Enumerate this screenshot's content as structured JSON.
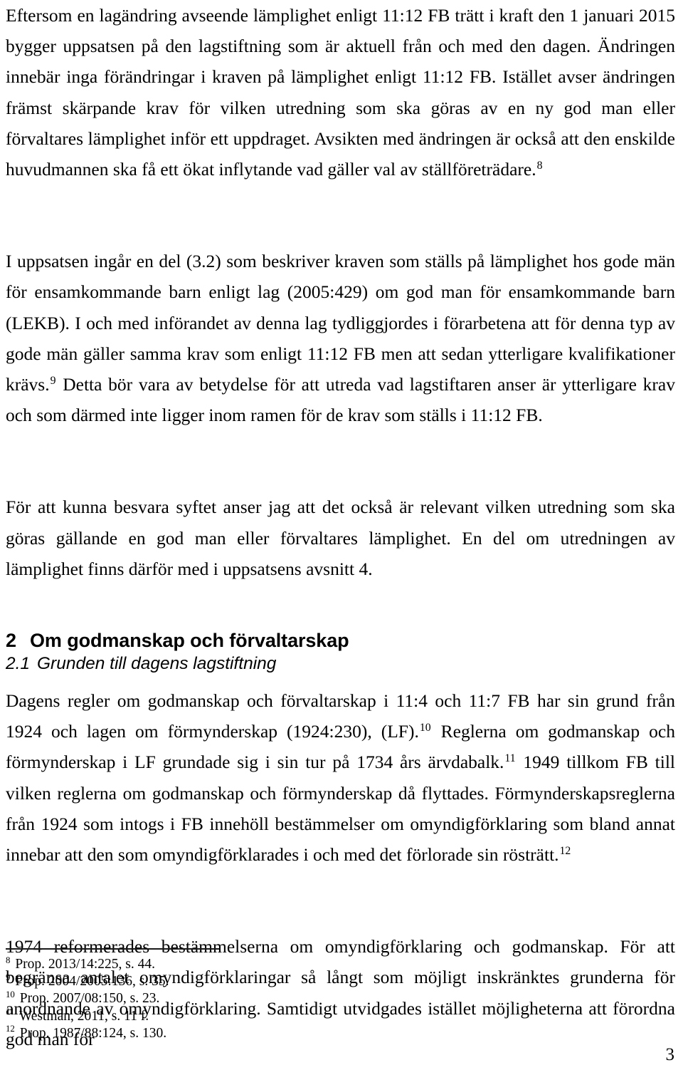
{
  "page": {
    "number": "3",
    "language": "sv"
  },
  "body": {
    "paragraphs": [
      {
        "id": "p-lagandring",
        "runs": [
          {
            "type": "text",
            "text": "Eftersom en lagändring avseende lämplighet enligt 11:12 FB trätt i kraft den 1 januari 2015 bygger uppsatsen på den lagstiftning som är aktuell från och med den dagen. Ändringen innebär inga förändringar i kraven på lämplighet enligt 11:12 FB. Istället avser ändringen främst skärpande krav för vilken utredning som ska göras av en ny god man eller förvaltares lämplighet inför ett uppdraget. Avsikten med ändringen är också att den enskilde huvudmannen ska få ett ökat inflytande vad gäller val av ställföreträdare."
          },
          {
            "type": "footnote-ref",
            "text": "8"
          }
        ]
      },
      {
        "id": "p-lekb",
        "runs": [
          {
            "type": "text",
            "text": "I uppsatsen ingår en del (3.2) som beskriver kraven som ställs på lämplighet hos gode män för ensamkommande barn enligt lag (2005:429) om god man för ensamkommande barn (LEKB). I och med införandet av denna lag tydliggjordes i förarbetena att för denna typ av gode män gäller samma krav som enligt 11:12 FB men att sedan ytterligare kvalifikationer krävs."
          },
          {
            "type": "footnote-ref",
            "text": "9"
          },
          {
            "type": "text",
            "text": " Detta bör vara av betydelse för att utreda vad lagstiftaren anser är ytterligare krav och som därmed inte ligger inom ramen för de krav som ställs i 11:12 FB."
          }
        ]
      },
      {
        "id": "p-syfte",
        "gap": "large",
        "runs": [
          {
            "type": "text",
            "text": "För att kunna besvara syftet anser jag att det också är relevant vilken utredning som ska göras gällande en god man eller förvaltares lämplighet. En del om utredningen av lämplighet finns därför med i uppsatsens avsnitt 4."
          }
        ]
      }
    ],
    "headings": {
      "h1": {
        "number": "2",
        "text": "Om godmanskap och förvaltarskap"
      },
      "h2": {
        "number": "2.1",
        "text": "Grunden till dagens lagstiftning"
      }
    },
    "paragraphs_after_heading": [
      {
        "id": "p-dagens-regler",
        "runs": [
          {
            "type": "text",
            "text": "Dagens regler om godmanskap och förvaltarskap i 11:4 och 11:7 FB har sin grund från 1924 och lagen om förmynderskap (1924:230), (LF)."
          },
          {
            "type": "footnote-ref",
            "text": "10"
          },
          {
            "type": "text",
            "text": " Reglerna om godmanskap och förmynderskap i LF grundade sig i sin tur på 1734 års ärvdabalk."
          },
          {
            "type": "footnote-ref",
            "text": "11"
          },
          {
            "type": "text",
            "text": " 1949 tillkom FB till vilken reglerna om godmanskap och förmynderskap då flyttades. Förmynderskapsreglerna från 1924 som intogs i FB innehöll bestämmelser om omyndigförklaring som bland annat innebar att den som omyndigförklarades i och med det förlorade sin rösträtt."
          },
          {
            "type": "footnote-ref",
            "text": "12"
          }
        ]
      },
      {
        "id": "p-1974",
        "gap": "large",
        "runs": [
          {
            "type": "text",
            "text": "1974 reformerades bestämmelserna om omyndigförklaring och godmanskap. För att begränsa antalet omyndigförklaringar så långt som möjligt inskränktes grunderna för anordnande av omyndigförklaring. Samtidigt utvidgades istället möjligheterna att förordna god man för"
          }
        ]
      }
    ]
  },
  "footnotes": {
    "items": [
      {
        "number": "8",
        "text": "Prop. 2013/14:225, s. 44."
      },
      {
        "number": "9",
        "text": "Prop. 2004/2005:136, s. 35."
      },
      {
        "number": "10",
        "text": "Prop. 2007/08:150, s. 23."
      },
      {
        "number": "11",
        "text": "Westman, 2011, s. 11 f."
      },
      {
        "number": "12",
        "text": "Prop. 1987/88:124, s. 130."
      }
    ]
  }
}
